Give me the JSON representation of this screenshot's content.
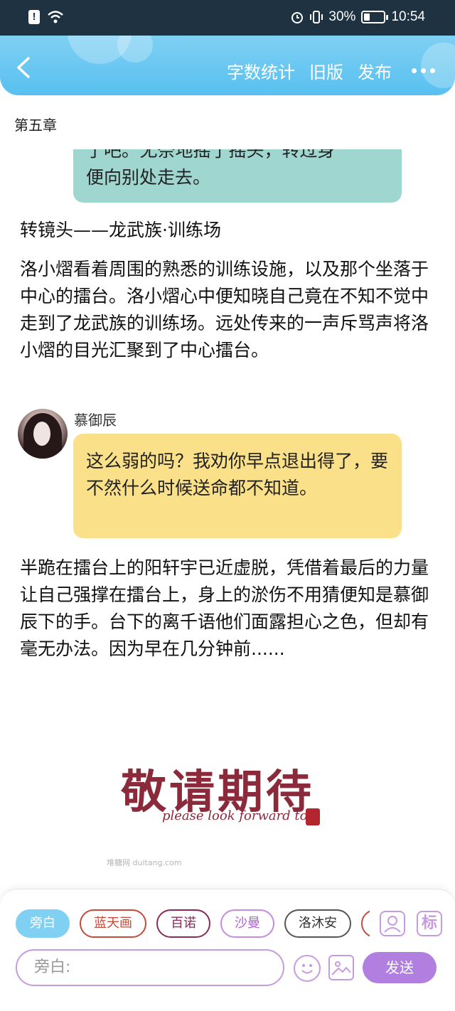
{
  "status_bar": {
    "battery_percent": "30%",
    "battery_level": 0.3,
    "time": "10:54"
  },
  "header": {
    "word_count": "字数统计",
    "old_version": "旧版",
    "publish": "发布"
  },
  "chapter_title": "第五章",
  "story": {
    "cut_top_line": "了吧。”无奈地摇了摇头，转过身",
    "green_bubble_line": "便向别处走去。",
    "scene_change": "转镜头——龙武族·训练场",
    "narration1": "洛小熠看着周围的熟悉的训练设施，以及那个坐落于中心的擂台。洛小熠心中便知晓自己竟在不知不觉中走到了龙武族的训练场。远处传来的一声斥骂声将洛小熠的目光汇聚到了中心擂台。",
    "speaker_name": "慕御辰",
    "speech": "这么弱的吗？我劝你早点退出得了，要不然什么时候送命都不知道。",
    "narration2": "半跪在擂台上的阳轩宇已近虚脱，凭借着最后的力量让自己强撑在擂台上，身上的淤伤不用猜便知是慕御辰下的手。台下的离千语他们面露担心之色，但却有毫无办法。因为早在几分钟前......"
  },
  "sticker": {
    "title": "敬请期待",
    "subtitle": "please look forward to",
    "watermark": "堆糖网 duitang.com"
  },
  "composer": {
    "characters": [
      "旁白",
      "蓝天画",
      "百诺",
      "沙曼",
      "洛沐安",
      ""
    ],
    "tag_label": "标",
    "input_placeholder": "旁白:",
    "send_label": "发送"
  },
  "colors": {
    "header": "#58c0f0",
    "green_bubble": "#9fd6cf",
    "yellow_bubble": "#fae189",
    "accent_purple": "#b07fe0"
  }
}
